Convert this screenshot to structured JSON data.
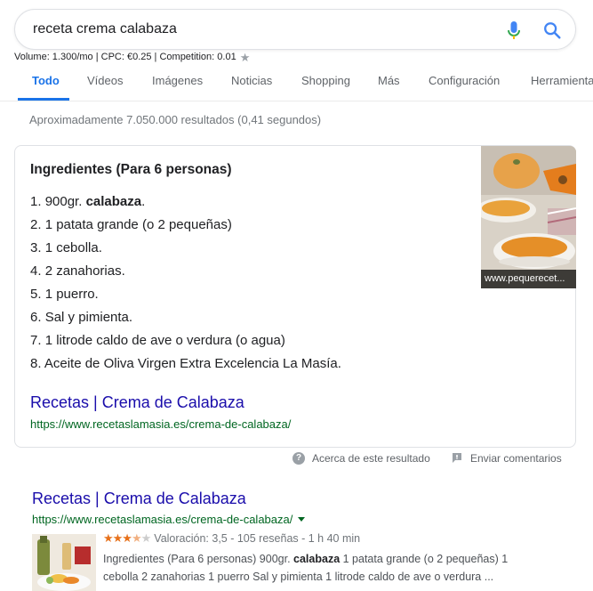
{
  "search": {
    "query": "receta crema calabaza"
  },
  "keyword_bar": {
    "text": "Volume: 1.300/mo | CPC: €0.25 | Competition: 0.01"
  },
  "tabs": [
    {
      "label": "Todo",
      "active": true
    },
    {
      "label": "Vídeos"
    },
    {
      "label": "Imágenes"
    },
    {
      "label": "Noticias"
    },
    {
      "label": "Shopping"
    },
    {
      "label": "Más"
    },
    {
      "label": "Configuración"
    },
    {
      "label": "Herramientas"
    }
  ],
  "stats": "Aproximadamente 7.050.000 resultados (0,41 segundos)",
  "snippet": {
    "heading": "Ingredientes (Para 6 personas)",
    "items": [
      {
        "num": "1.",
        "pre": "900gr. ",
        "bold": "calabaza",
        "post": "."
      },
      {
        "num": "2.",
        "pre": "1 patata grande (o 2 pequeñas)",
        "bold": "",
        "post": ""
      },
      {
        "num": "3.",
        "pre": "1 cebolla.",
        "bold": "",
        "post": ""
      },
      {
        "num": "4.",
        "pre": "2 zanahorias.",
        "bold": "",
        "post": ""
      },
      {
        "num": "5.",
        "pre": "1 puerro.",
        "bold": "",
        "post": ""
      },
      {
        "num": "6.",
        "pre": "Sal y pimienta.",
        "bold": "",
        "post": ""
      },
      {
        "num": "7.",
        "pre": "1 litrode caldo de ave o verdura (o agua)",
        "bold": "",
        "post": ""
      },
      {
        "num": "8.",
        "pre": "Aceite de Oliva Virgen Extra Excelencia La Masía.",
        "bold": "",
        "post": ""
      }
    ],
    "link_title": "Recetas | Crema de Calabaza",
    "link_url": "https://www.recetaslamasia.es/crema-de-calabaza/",
    "image_caption": "www.pequerecet..."
  },
  "feedback": {
    "about": "Acerca de este resultado",
    "send": "Enviar comentarios"
  },
  "result": {
    "title": "Recetas | Crema de Calabaza",
    "url": "https://www.recetaslamasia.es/crema-de-calabaza/",
    "rating_text": "Valoración: 3,5 - 105 reseñas - 1 h 40 min",
    "stars_filled": "★★★",
    "stars_half": "★",
    "stars_empty": "★",
    "snippet_line1_pre": "Ingredientes (Para 6 personas) 900gr. ",
    "snippet_line1_bold": "calabaza",
    "snippet_line1_post": " 1 patata grande (o 2 pequeñas) 1",
    "snippet_line2": "cebolla 2 zanahorias 1 puerro Sal y pimienta 1 litrode caldo de ave o verdura ..."
  },
  "colors": {
    "link": "#1a0dab",
    "url": "#006621",
    "accent": "#1a73e8",
    "star": "#e7711b"
  }
}
